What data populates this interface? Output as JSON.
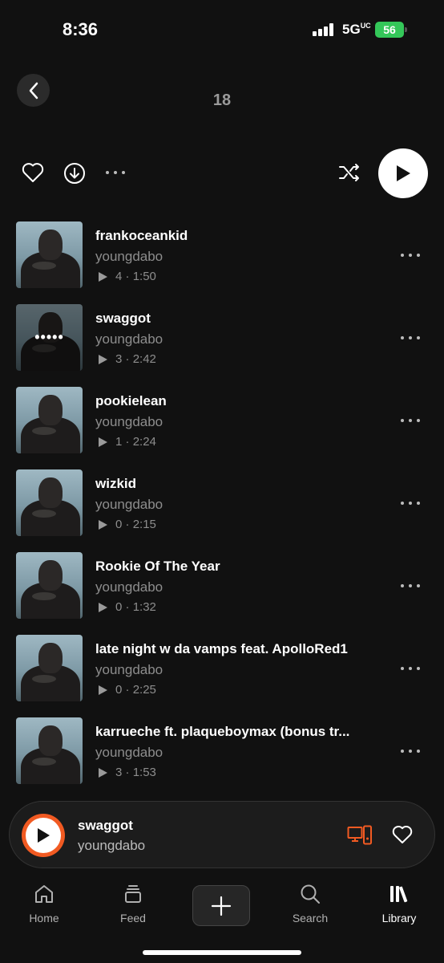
{
  "status": {
    "time": "8:36",
    "network": "5G",
    "network_suffix": "UC",
    "battery": "56"
  },
  "header": {
    "title": "18"
  },
  "tracks": [
    {
      "title": "frankoceankid",
      "artist": "youngdabo",
      "plays": "4",
      "duration": "1:50"
    },
    {
      "title": "swaggot",
      "artist": "youngdabo",
      "plays": "3",
      "duration": "2:42",
      "now_playing": true
    },
    {
      "title": "pookielean",
      "artist": "youngdabo",
      "plays": "1",
      "duration": "2:24"
    },
    {
      "title": "wizkid",
      "artist": "youngdabo",
      "plays": "0",
      "duration": "2:15"
    },
    {
      "title": "Rookie Of The Year",
      "artist": "youngdabo",
      "plays": "0",
      "duration": "1:32"
    },
    {
      "title": "late night w da vamps feat. ApolloRed1",
      "artist": "youngdabo",
      "plays": "0",
      "duration": "2:25"
    },
    {
      "title": "karrueche ft. plaqueboymax (bonus tr...",
      "artist": "youngdabo",
      "plays": "3",
      "duration": "1:53"
    }
  ],
  "mini_player": {
    "title": "swaggot",
    "artist": "youngdabo",
    "accent": "#f15a22"
  },
  "tabs": [
    {
      "label": "Home",
      "icon": "home-icon"
    },
    {
      "label": "Feed",
      "icon": "feed-icon"
    },
    {
      "label": "Search",
      "icon": "search-icon"
    },
    {
      "label": "Library",
      "icon": "library-icon",
      "active": true
    }
  ],
  "colors": {
    "background": "#111111",
    "battery": "#34c759",
    "accent": "#f15a22"
  }
}
